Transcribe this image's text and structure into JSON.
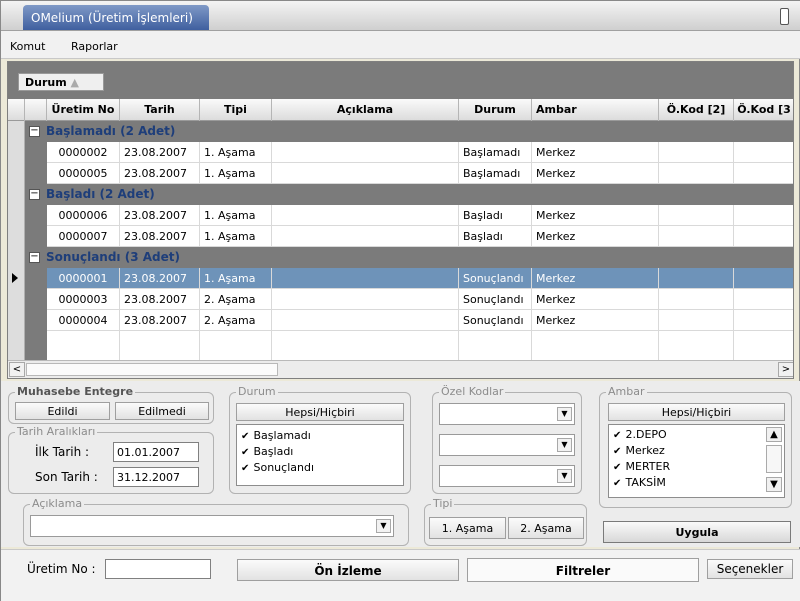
{
  "window": {
    "title": "OMelium (Üretim İşlemleri)"
  },
  "menu": [
    "Komut",
    "Raporlar"
  ],
  "grid": {
    "group_by": "Durum",
    "columns": [
      "Üretim No",
      "Tarih",
      "Tipi",
      "Açıklama",
      "Durum",
      "Ambar",
      "Ö.Kod [2]",
      "Ö.Kod [3"
    ],
    "groups": [
      {
        "label": "Başlamadı (2 Adet)",
        "rows": [
          {
            "no": "0000002",
            "tarih": "23.08.2007",
            "tipi": "1. Aşama",
            "aciklama": "",
            "durum": "Başlamadı",
            "ambar": "Merkez"
          },
          {
            "no": "0000005",
            "tarih": "23.08.2007",
            "tipi": "1. Aşama",
            "aciklama": "",
            "durum": "Başlamadı",
            "ambar": "Merkez"
          }
        ]
      },
      {
        "label": "Başladı (2 Adet)",
        "rows": [
          {
            "no": "0000006",
            "tarih": "23.08.2007",
            "tipi": "1. Aşama",
            "aciklama": "",
            "durum": "Başladı",
            "ambar": "Merkez"
          },
          {
            "no": "0000007",
            "tarih": "23.08.2007",
            "tipi": "1. Aşama",
            "aciklama": "",
            "durum": "Başladı",
            "ambar": "Merkez"
          }
        ]
      },
      {
        "label": "Sonuçlandı (3 Adet)",
        "rows": [
          {
            "no": "0000001",
            "tarih": "23.08.2007",
            "tipi": "1. Aşama",
            "aciklama": "",
            "durum": "Sonuçlandı",
            "ambar": "Merkez"
          },
          {
            "no": "0000003",
            "tarih": "23.08.2007",
            "tipi": "2. Aşama",
            "aciklama": "",
            "durum": "Sonuçlandı",
            "ambar": "Merkez"
          },
          {
            "no": "0000004",
            "tarih": "23.08.2007",
            "tipi": "2. Aşama",
            "aciklama": "",
            "durum": "Sonuçlandı",
            "ambar": "Merkez"
          }
        ]
      }
    ],
    "selected_row": "0000001",
    "scroll_left": "<",
    "scroll_right": ">"
  },
  "muhasebe": {
    "legend": "Muhasebe Entegre",
    "edildi": "Edildi",
    "edilmedi": "Edilmedi"
  },
  "tarih": {
    "legend": "Tarih Aralıkları",
    "ilk_label": "İlk Tarih :",
    "ilk_value": "01.01.2007",
    "son_label": "Son Tarih :",
    "son_value": "31.12.2007"
  },
  "durum": {
    "legend": "Durum",
    "hepsi": "Hepsi/Hiçbiri",
    "items": [
      "Başlamadı",
      "Başladı",
      "Sonuçlandı"
    ]
  },
  "ozel": {
    "legend": "Özel Kodlar"
  },
  "ambar": {
    "legend": "Ambar",
    "hepsi": "Hepsi/Hiçbiri",
    "items": [
      "2.DEPO",
      "Merkez",
      "MERTER",
      "TAKSİM"
    ]
  },
  "aciklama": {
    "legend": "Açıklama"
  },
  "tipi": {
    "legend": "Tipi",
    "a1": "1. Aşama",
    "a2": "2. Aşama"
  },
  "actions": {
    "uygula": "Uygula",
    "on_izleme": "Ön İzleme",
    "filtreler": "Filtreler",
    "secenekler": "Seçenekler"
  },
  "uretim_label": "Üretim No :",
  "check_mark": "✔",
  "colors": {
    "selected": "#6e93b9",
    "group_text": "#1e3e7a",
    "title": "#3f5f9f"
  }
}
